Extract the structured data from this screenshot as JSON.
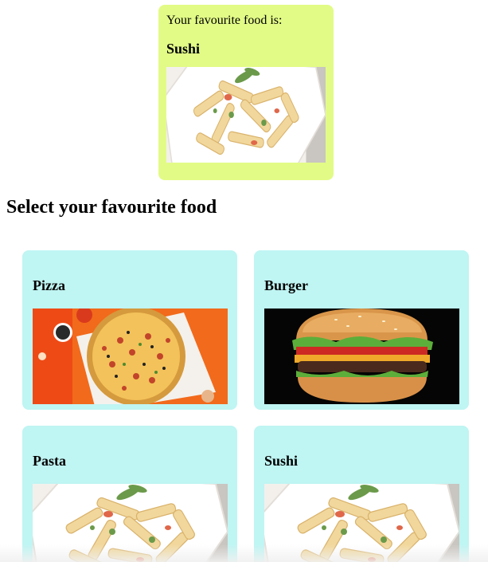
{
  "favourite": {
    "prefix": "Your favourite food is:",
    "name": "Sushi",
    "image": "pasta-bowl-image"
  },
  "section_title": "Select your favourite food",
  "foods": [
    {
      "name": "Pizza",
      "image": "pizza-image"
    },
    {
      "name": "Burger",
      "image": "burger-image"
    },
    {
      "name": "Pasta",
      "image": "pasta-bowl-image"
    },
    {
      "name": "Sushi",
      "image": "pasta-bowl-image"
    }
  ],
  "colors": {
    "favourite_card_bg": "#e2fb86",
    "food_card_bg": "#bff5f3"
  }
}
